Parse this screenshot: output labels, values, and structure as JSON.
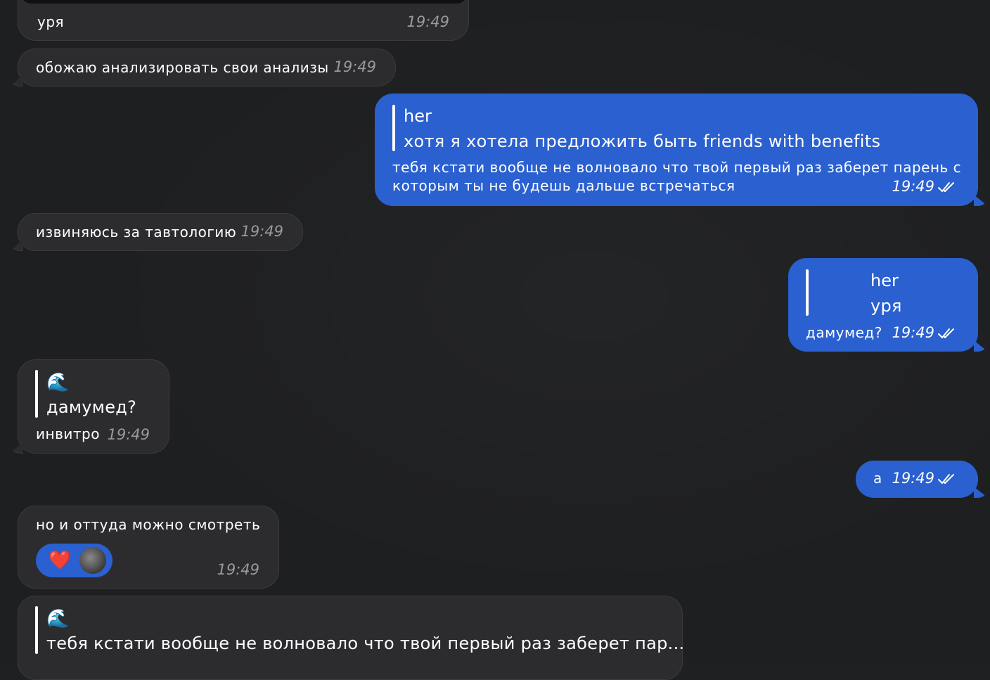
{
  "messages": {
    "m1": {
      "text": "уря",
      "time": "19:49"
    },
    "m2": {
      "text": "обожаю анализировать свои анализы",
      "time": "19:49"
    },
    "m3": {
      "reply_name": "her",
      "reply_text": "хотя я хотела предложить быть friends with benefits",
      "line1": "тебя кстати вообще не волновало что твой первый раз заберет парень с",
      "line2": "которым ты не будешь дальше встречаться",
      "time": "19:49"
    },
    "m4": {
      "text": "извиняюсь за тавтологию",
      "time": "19:49"
    },
    "m5": {
      "reply_name": "her",
      "reply_text": "уря",
      "text": "дамумед?",
      "time": "19:49"
    },
    "m6": {
      "reply_name": "🌊",
      "reply_text": "дамумед?",
      "text": "инвитро",
      "time": "19:49"
    },
    "m7": {
      "text": "а",
      "time": "19:49"
    },
    "m8": {
      "text": "но и оттуда можно смотреть",
      "reaction": "❤️",
      "time": "19:49"
    },
    "m9": {
      "reply_name": "🌊",
      "reply_text": "тебя кстати вообще не волновало что твой первый раз заберет пар..."
    }
  },
  "colors": {
    "incoming_bubble": "#2c2c2e",
    "outgoing_bubble": "#2a60cf",
    "background": "#1e1f21"
  },
  "icons": {
    "read_status": "double-check-icon",
    "reply_sender": "wave-emoji"
  }
}
